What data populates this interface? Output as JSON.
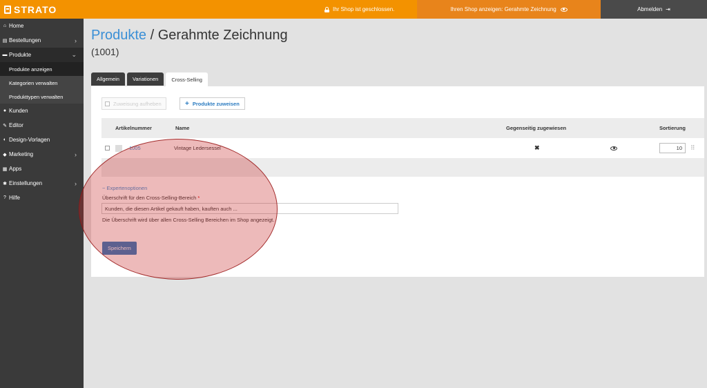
{
  "topbar": {
    "logo_text": "STRATO",
    "shop_closed_text": "Ihr Shop ist geschlossen.",
    "shop_view_text": "Ihren Shop anzeigen: Gerahmte Zeichnung",
    "logout_text": "Abmelden",
    "colors": {
      "bar": "#f39200",
      "shop_view": "#e8841b",
      "logout": "#4a4a4a"
    }
  },
  "sidebar": {
    "items": [
      {
        "label": "Home",
        "icon": "home-icon",
        "glyph": "⌂"
      },
      {
        "label": "Bestellungen",
        "icon": "orders-icon",
        "glyph": "▤",
        "chevron": "›"
      },
      {
        "label": "Produkte",
        "icon": "cart-icon",
        "glyph": "▬",
        "chevron": "⌄",
        "active": true,
        "children": [
          "Produkte anzeigen",
          "Kategorien verwalten",
          "Produkttypen verwalten"
        ]
      },
      {
        "label": "Kunden",
        "icon": "user-icon",
        "glyph": "●"
      },
      {
        "label": "Editor",
        "icon": "pencil-icon",
        "glyph": "✎"
      },
      {
        "label": "Design-Vorlagen",
        "icon": "brush-icon",
        "glyph": "◐"
      },
      {
        "label": "Marketing",
        "icon": "tag-icon",
        "glyph": "◆",
        "chevron": "›"
      },
      {
        "label": "Apps",
        "icon": "apps-icon",
        "glyph": "▦"
      },
      {
        "label": "Einstellungen",
        "icon": "gear-icon",
        "glyph": "✱",
        "chevron": "›"
      },
      {
        "label": "Hilfe",
        "icon": "help-icon",
        "glyph": "?"
      }
    ]
  },
  "page": {
    "breadcrumb_link": "Produkte",
    "title_separator": " / ",
    "title": "Gerahmte Zeichnung",
    "subtitle": "(1001)"
  },
  "tabs": [
    {
      "label": "Allgemein",
      "active": false
    },
    {
      "label": "Variationen",
      "active": false
    },
    {
      "label": "Cross-Selling",
      "active": true
    }
  ],
  "toolbar": {
    "unassign_label": "Zuweisung aufheben",
    "assign_label": "Produkte zuweisen"
  },
  "table": {
    "headers": {
      "article_number": "Artikelnummer",
      "name": "Name",
      "mutual": "Gegenseitig zugewiesen",
      "sort": "Sortierung"
    },
    "rows": [
      {
        "article_number": "1005",
        "name": "Vintage Ledersessel",
        "mutual": "✖",
        "sort": "10"
      }
    ]
  },
  "expert": {
    "toggle_label": "− Expertenoptionen",
    "field_label": "Überschrift für den Cross-Selling-Bereich",
    "required_mark": "*",
    "field_value": "Kunden, die diesen Artikel gekauft haben, kauften auch ...",
    "help_text": "Die Überschrift wird über allen Cross-Selling Bereichen im Shop angezeigt."
  },
  "save_label": "Speichern",
  "highlight_color": "#c82828"
}
